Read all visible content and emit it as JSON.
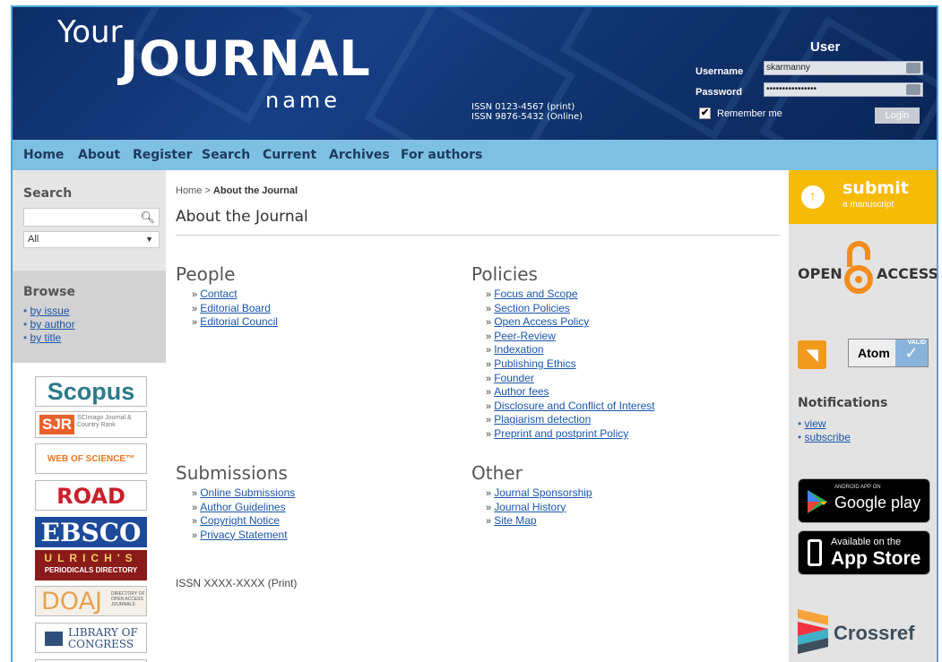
{
  "header": {
    "logo_your": "Your",
    "logo_journal": "JOURNAL",
    "logo_name": "name",
    "issn_print": "ISSN 0123-4567 (print)",
    "issn_online": "ISSN 9876-5432 (Online)"
  },
  "login": {
    "title": "User",
    "username_label": "Username",
    "username_value": "skarmanny",
    "password_label": "Password",
    "password_value": "••••••••••••••••",
    "remember_label": "Remember me",
    "remember_checked": true,
    "login_button": "Login"
  },
  "nav": {
    "items": [
      "Home",
      "About",
      "Register",
      "Search",
      "Current",
      "Archives",
      "For authors"
    ]
  },
  "left": {
    "search_title": "Search",
    "search_placeholder": "",
    "search_scope": "All",
    "browse_title": "Browse",
    "browse_items": [
      "by issue",
      "by author",
      "by title"
    ],
    "indexes": {
      "scopus": "Scopus",
      "sjr": "SJR",
      "sjr_sub": "SCImago Journal & Country Rank",
      "wos": "WEB OF SCIENCE™",
      "road": "ROAD",
      "ebsco": "EBSCO",
      "ulrichs": "ULRICH'S",
      "ulrichs_sub": "PERIODICALS DIRECTORY",
      "doaj": "DOAJ",
      "doaj_sub": "DIRECTORY OF OPEN ACCESS JOURNALS",
      "loc_line1": "LIBRARY OF",
      "loc_line2": "CONGRESS"
    }
  },
  "main": {
    "breadcrumb_home": "Home",
    "breadcrumb_sep": ">",
    "breadcrumb_current": "About the Journal",
    "title": "About the Journal",
    "people": {
      "heading": "People",
      "links": [
        "Contact",
        "Editorial Board",
        "Editorial Council"
      ]
    },
    "policies": {
      "heading": "Policies",
      "links": [
        "Focus and Scope",
        "Section Policies",
        "Open Access Policy",
        "Peer-Review",
        "Indexation",
        "Publishing Ethics",
        "Founder",
        "Author fees",
        "Disclosure and Conflict of Interest",
        "Plagiarism detection",
        "Preprint and postprint Policy"
      ]
    },
    "submissions": {
      "heading": "Submissions",
      "links": [
        "Online Submissions",
        "Author Guidelines",
        "Copyright Notice",
        "Privacy Statement"
      ]
    },
    "other": {
      "heading": "Other",
      "links": [
        "Journal Sponsorship",
        "Journal History",
        "Site Map"
      ]
    },
    "issn_footer": "ISSN XXXX-XXXX (Print)"
  },
  "right": {
    "submit_main": "submit",
    "submit_sub": "a manuscript",
    "open_access_left": "OPEN",
    "open_access_right": "ACCESS",
    "atom_label": "Atom",
    "atom_valid": "VALID",
    "notifications_title": "Notifications",
    "notification_items": [
      "view",
      "subscribe"
    ],
    "google_play_top": "ANDROID APP ON",
    "google_play_main": "Google play",
    "app_store_top": "Available on the",
    "app_store_main": "App Store",
    "crossref": "Crossref"
  },
  "colors": {
    "header_bg": "#173f86",
    "nav_bg": "#7ec0e2",
    "submit_bg": "#f5bb06",
    "link": "#1a56a8",
    "open_access_orange": "#f28c1c"
  }
}
